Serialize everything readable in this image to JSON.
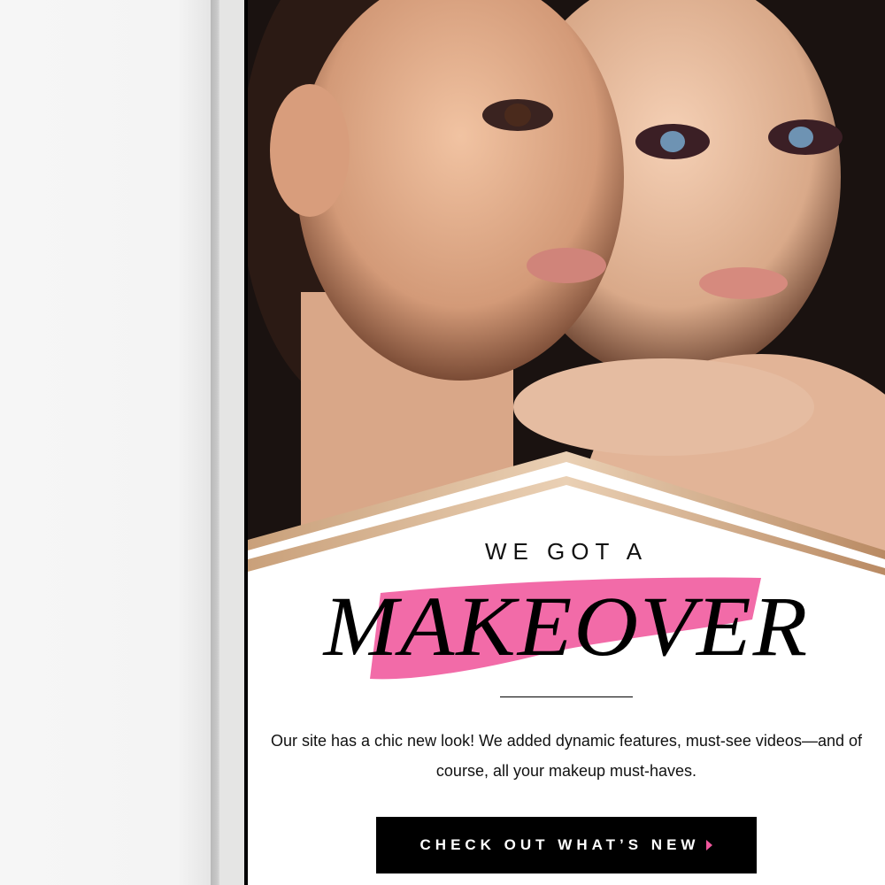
{
  "email": {
    "headline": "WE GOT A",
    "title": "MAKEOVER",
    "body": "Our site has a chic new look! We added dynamic features, must-see videos—and of course, all your makeup must-haves.",
    "cta_label": "CHECK OUT WHAT’S NEW",
    "cta_icon": "caret-right-icon"
  },
  "colors": {
    "accent_pink": "#f0569c",
    "gold": "#c9a07a",
    "button": "#000000"
  }
}
